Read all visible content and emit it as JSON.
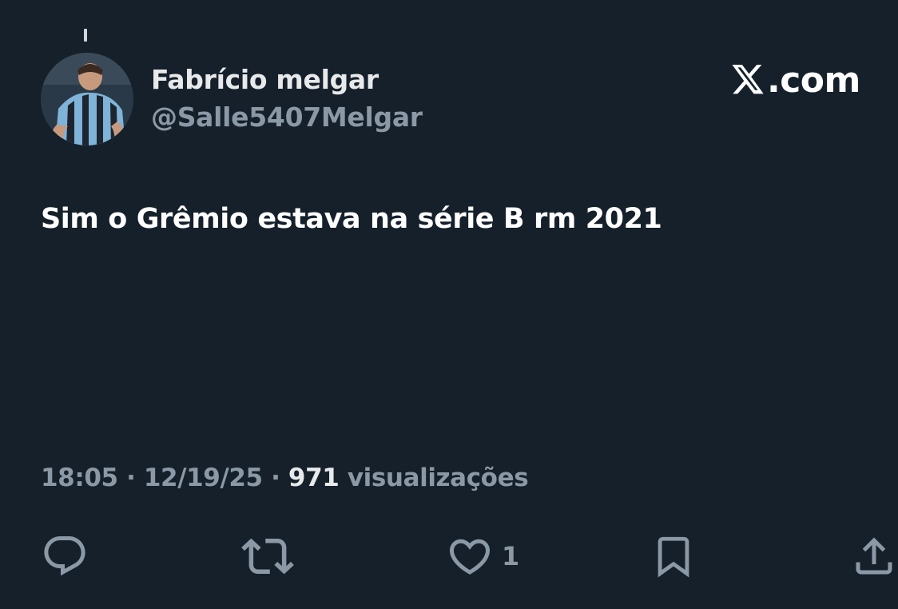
{
  "author": {
    "display_name": "Fabrício melgar",
    "handle": "@Salle5407Melgar"
  },
  "brand": {
    "label": ".com",
    "logo": "x-logo-icon"
  },
  "tweet": {
    "text": "Sim o Grêmio estava na série B rm 2021"
  },
  "meta": {
    "time": "18:05",
    "separator": " · ",
    "date": "12/19/25",
    "views_count": "971",
    "views_label": " visualizações"
  },
  "actions": {
    "reply": {
      "icon": "reply-icon"
    },
    "repost": {
      "icon": "repost-icon"
    },
    "like": {
      "icon": "heart-icon",
      "count": "1"
    },
    "bookmark": {
      "icon": "bookmark-icon"
    },
    "share": {
      "icon": "share-icon"
    }
  },
  "colors": {
    "background": "#15202b",
    "primary_text": "#e7e9ea",
    "secondary_text": "#8b98a5"
  }
}
